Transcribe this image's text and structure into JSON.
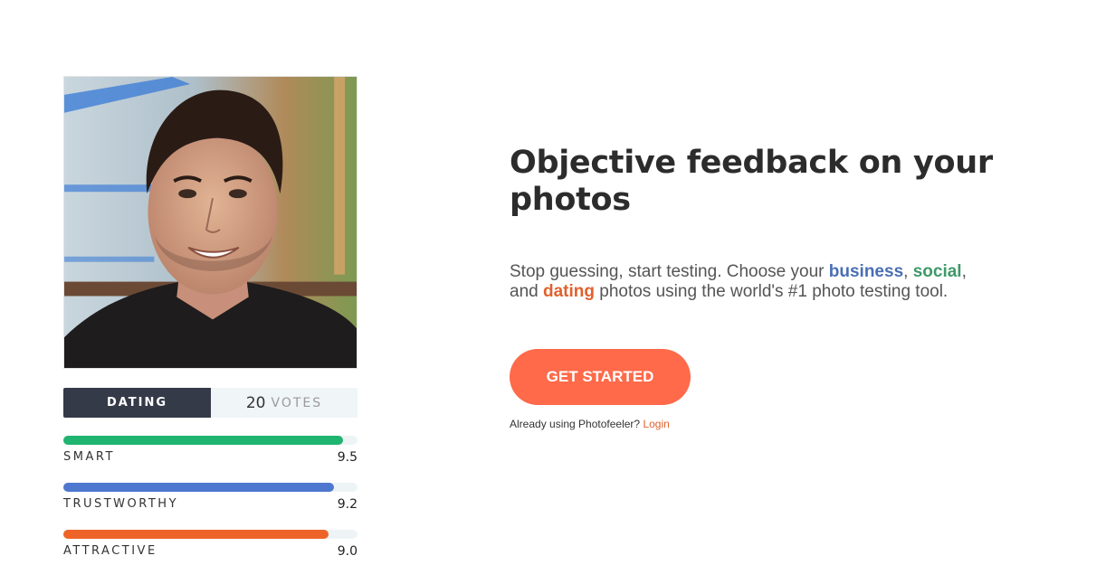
{
  "card": {
    "photo_alt": "profile-photo",
    "tabs": {
      "dating_label": "DATING",
      "votes_count": "20",
      "votes_label": "VOTES"
    },
    "metrics": [
      {
        "name": "SMART",
        "score": "9.5",
        "fill_fraction": 0.95,
        "color": "#1fb46f"
      },
      {
        "name": "TRUSTWORTHY",
        "score": "9.2",
        "fill_fraction": 0.92,
        "color": "#4e78cf"
      },
      {
        "name": "ATTRACTIVE",
        "score": "9.0",
        "fill_fraction": 0.9,
        "color": "#ee6428"
      }
    ]
  },
  "hero": {
    "headline": "Objective feedback on your photos",
    "sub_before_business": "Stop guessing, start testing. Choose your ",
    "kw_business": "business",
    "sub_comma": ", ",
    "kw_social": "social",
    "sub_and": ", and ",
    "kw_dating": "dating",
    "sub_after": " photos using the world's #1 photo testing tool.",
    "cta_label": "GET STARTED",
    "already_text": "Already using Photofeeler? ",
    "login_label": "Login"
  },
  "colors": {
    "cta": "#fe6a4a",
    "dating_tab": "#353a49",
    "business": "#4a6eb5",
    "social": "#3e9a6a",
    "dating": "#e0622e"
  }
}
